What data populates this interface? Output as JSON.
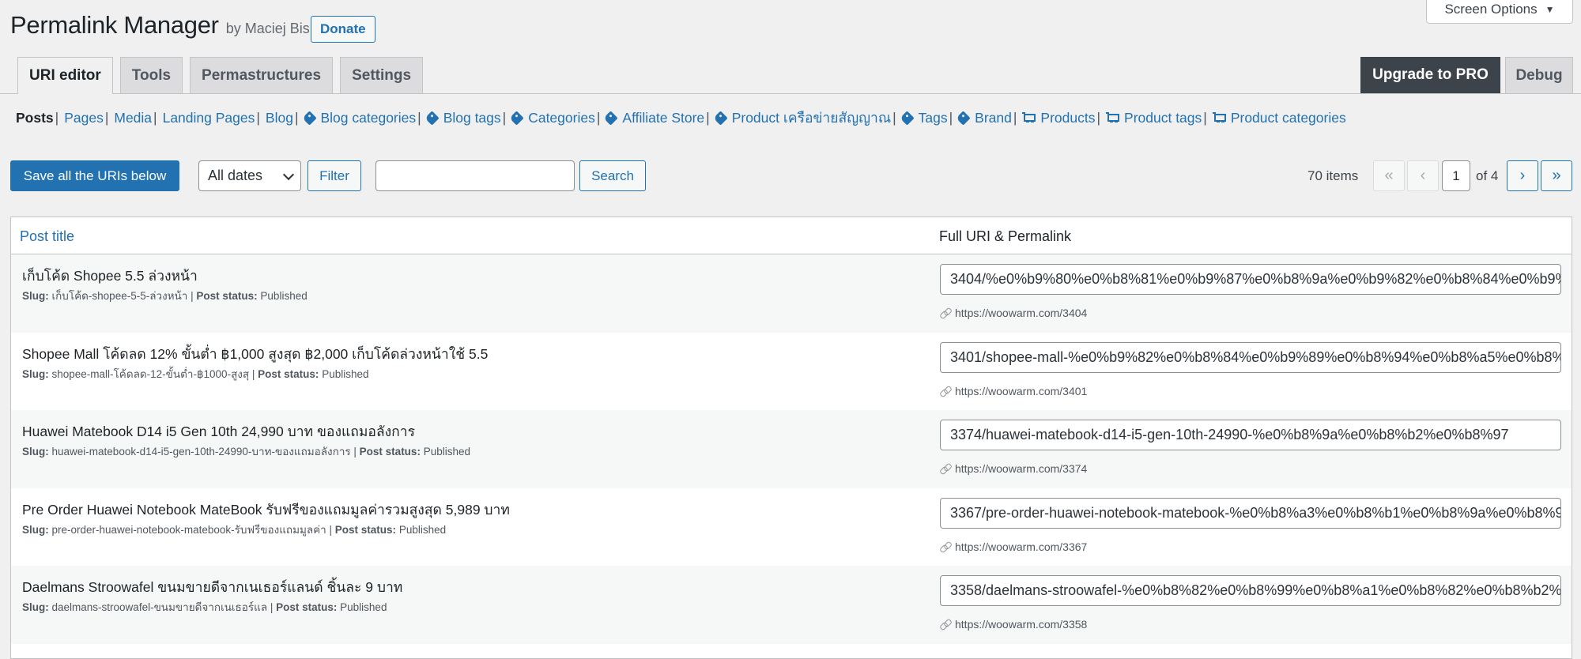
{
  "header": {
    "title": "Permalink Manager",
    "byline": "by Maciej Bis",
    "donate_label": "Donate",
    "screen_options_label": "Screen Options"
  },
  "tabs": [
    {
      "label": "URI editor",
      "active": true
    },
    {
      "label": "Tools"
    },
    {
      "label": "Permastructures"
    },
    {
      "label": "Settings"
    }
  ],
  "upgrade_label": "Upgrade to PRO",
  "debug_label": "Debug",
  "subnav": [
    {
      "label": "Posts",
      "icon": "",
      "current": true
    },
    {
      "label": "Pages",
      "icon": ""
    },
    {
      "label": "Media",
      "icon": ""
    },
    {
      "label": "Landing Pages",
      "icon": ""
    },
    {
      "label": "Blog",
      "icon": ""
    },
    {
      "label": "Blog categories",
      "icon": "tag-icon"
    },
    {
      "label": "Blog tags",
      "icon": "tag-icon"
    },
    {
      "label": "Categories",
      "icon": "tag-icon"
    },
    {
      "label": "Affiliate Store",
      "icon": "tag-icon"
    },
    {
      "label": "Product เครือข่ายสัญญาณ",
      "icon": "tag-icon"
    },
    {
      "label": "Tags",
      "icon": "tag-icon"
    },
    {
      "label": "Brand",
      "icon": "tag-icon"
    },
    {
      "label": "Products",
      "icon": "cart-icon"
    },
    {
      "label": "Product tags",
      "icon": "cart-icon"
    },
    {
      "label": "Product categories",
      "icon": "cart-icon"
    }
  ],
  "toolbar": {
    "save_label": "Save all the URIs below",
    "date_filter_value": "All dates",
    "filter_label": "Filter",
    "search_value": "",
    "search_label": "Search"
  },
  "pagination": {
    "items_text": "70 items",
    "first": "«",
    "prev": "‹",
    "current_page": "1",
    "of_text": "of 4",
    "next": "›",
    "last": "»"
  },
  "table": {
    "col_title": "Post title",
    "col_uri": "Full URI & Permalink",
    "slug_label": "Slug:",
    "status_label": "Post status:",
    "rows": [
      {
        "title": "เก็บโค้ด Shopee 5.5 ล่วงหน้า",
        "slug": "เก็บโค้ด-shopee-5-5-ล่วงหน้า",
        "status": "Published",
        "uri": "3404/%e0%b9%80%e0%b8%81%e0%b9%87%e0%b8%9a%e0%b9%82%e0%b8%84%e0%b9%89%e0%b8%94",
        "permalink": "https://woowarm.com/3404"
      },
      {
        "title": "Shopee Mall โค้ดลด 12% ขั้นต่ำ ฿1,000 สูงสุด ฿2,000 เก็บโค้ดล่วงหน้าใช้ 5.5",
        "slug": "shopee-mall-โค้ดลด-12-ขั้นต่ำ-฿1000-สูงสุ",
        "status": "Published",
        "uri": "3401/shopee-mall-%e0%b9%82%e0%b8%84%e0%b9%89%e0%b8%94%e0%b8%a5%e0%b8%94",
        "permalink": "https://woowarm.com/3401"
      },
      {
        "title": "Huawei Matebook D14 i5 Gen 10th 24,990 บาท ของแถมอลังการ",
        "slug": "huawei-matebook-d14-i5-gen-10th-24990-บาท-ของแถมอลังการ",
        "status": "Published",
        "uri": "3374/huawei-matebook-d14-i5-gen-10th-24990-%e0%b8%9a%e0%b8%b2%e0%b8%97",
        "permalink": "https://woowarm.com/3374"
      },
      {
        "title": "Pre Order Huawei Notebook MateBook รับฟรีของแถมมูลค่ารวมสูงสุด 5,989 บาท",
        "slug": "pre-order-huawei-notebook-matebook-รับฟรีของแถมมูลค่า",
        "status": "Published",
        "uri": "3367/pre-order-huawei-notebook-matebook-%e0%b8%a3%e0%b8%b1%e0%b8%9a%e0%b8%9f",
        "permalink": "https://woowarm.com/3367"
      },
      {
        "title": "Daelmans Stroowafel ขนมขายดีจากเนเธอร์แลนด์ ชิ้นละ 9 บาท",
        "slug": "daelmans-stroowafel-ขนมขายดีจากเนเธอร์แล",
        "status": "Published",
        "uri": "3358/daelmans-stroowafel-%e0%b8%82%e0%b8%99%e0%b8%a1%e0%b8%82%e0%b8%b2%e0%b8%a2",
        "permalink": "https://woowarm.com/3358"
      }
    ]
  },
  "colors": {
    "accent": "#2271b1",
    "upgrade_bg": "#3c434a",
    "page_bg": "#f0f0f1"
  }
}
